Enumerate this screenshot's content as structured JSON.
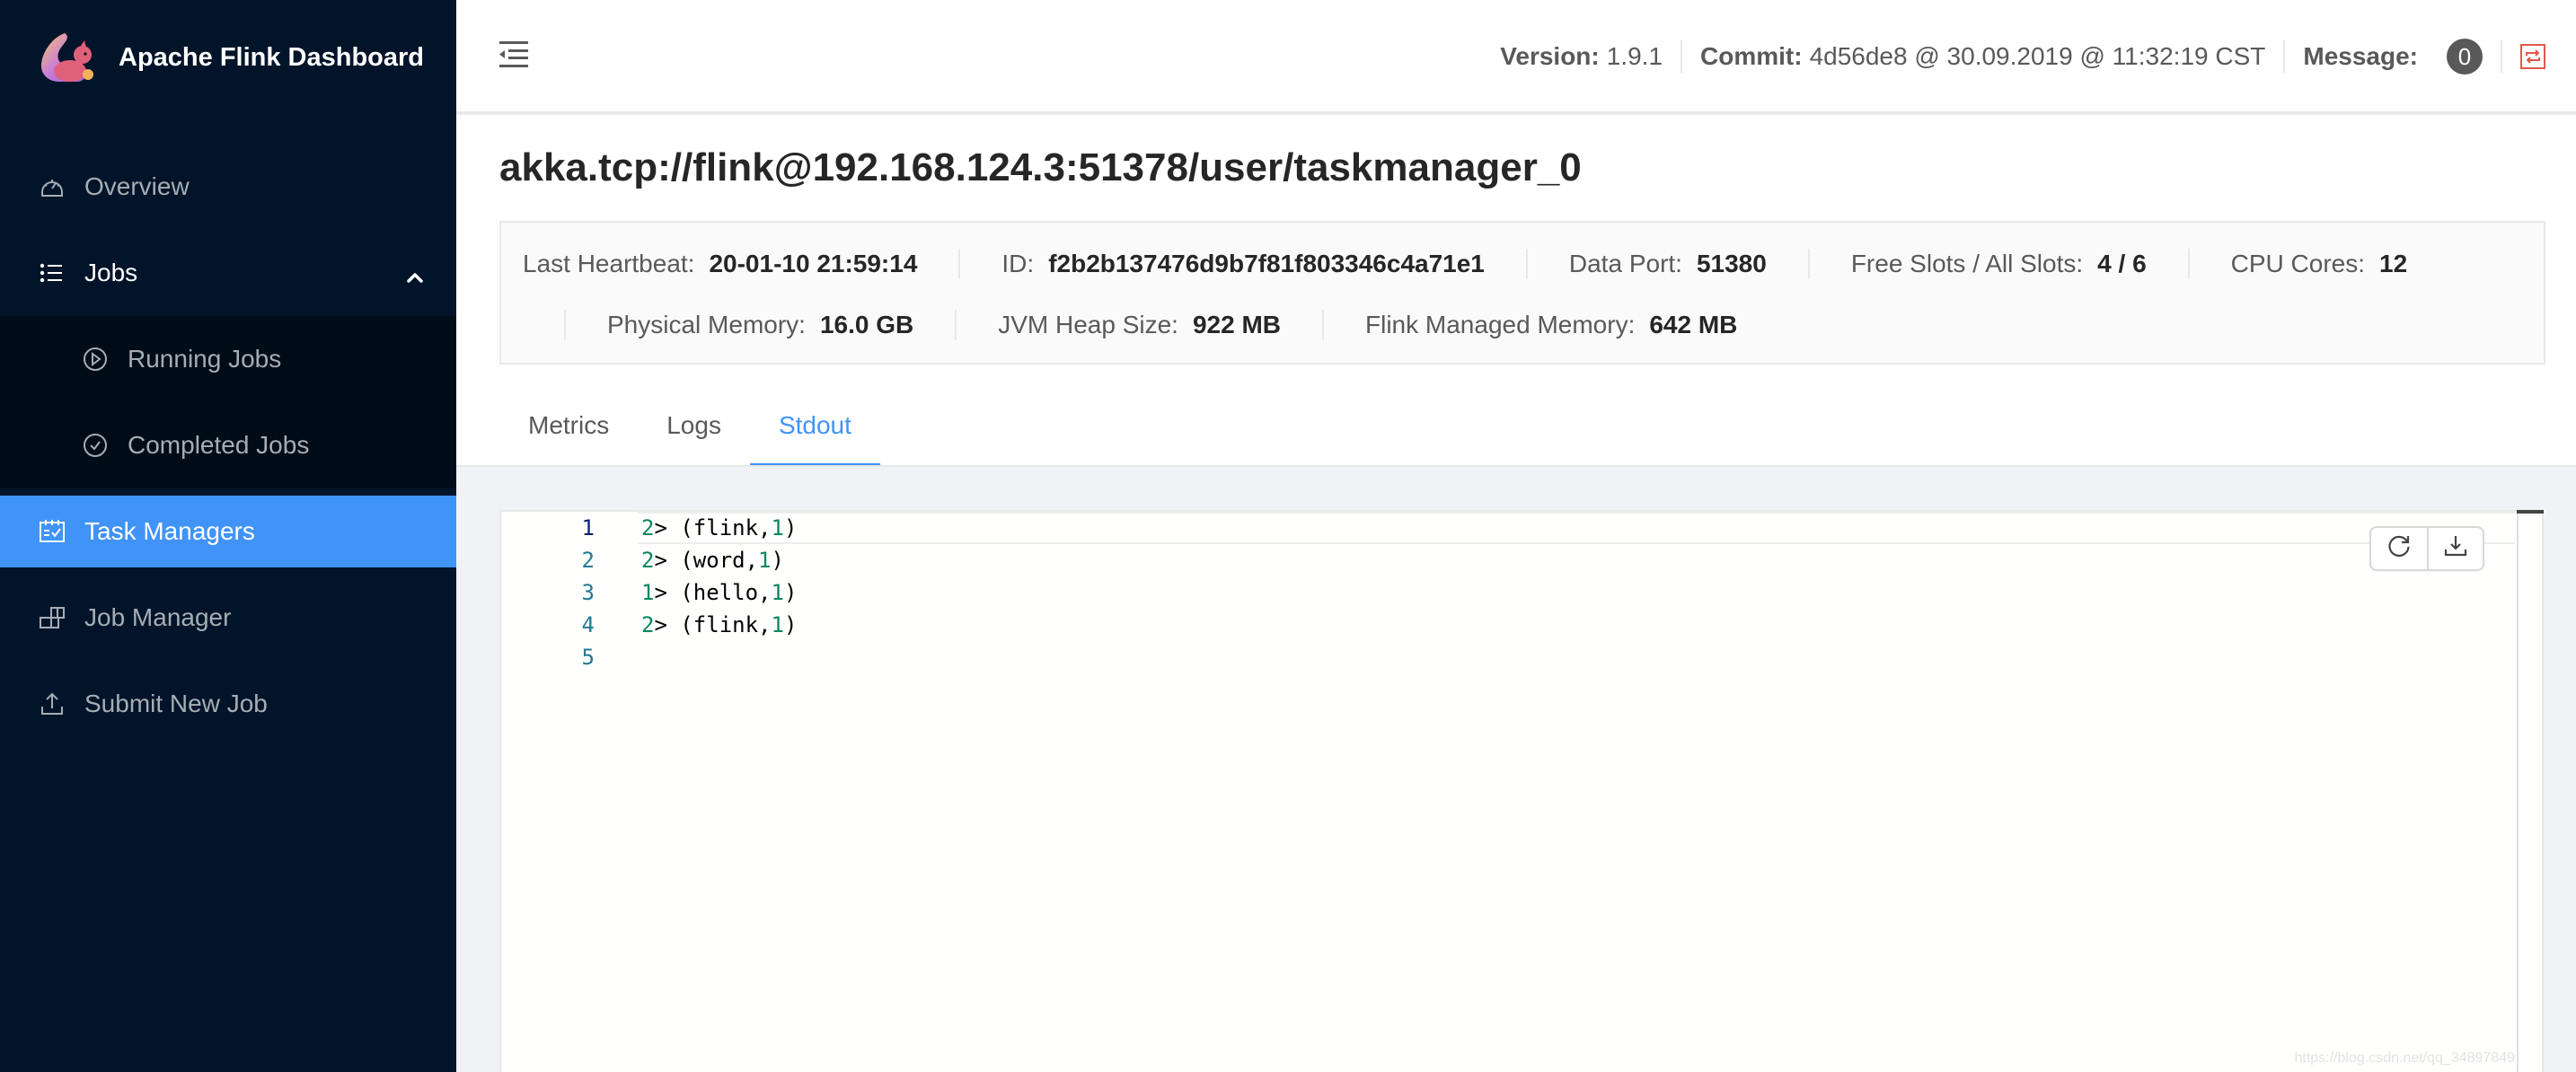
{
  "app": {
    "title": "Apache Flink Dashboard"
  },
  "sidebar": {
    "items": [
      {
        "label": "Overview",
        "icon": "dashboard-icon"
      },
      {
        "label": "Jobs",
        "icon": "list-icon",
        "expanded": true,
        "children": [
          {
            "label": "Running Jobs",
            "icon": "play-circle-icon"
          },
          {
            "label": "Completed Jobs",
            "icon": "check-circle-icon"
          }
        ]
      },
      {
        "label": "Task Managers",
        "icon": "schedule-icon",
        "active": true
      },
      {
        "label": "Job Manager",
        "icon": "build-icon"
      },
      {
        "label": "Submit New Job",
        "icon": "upload-icon"
      }
    ],
    "active_color": "#4093f7"
  },
  "header": {
    "version_label": "Version:",
    "version_value": "1.9.1",
    "commit_label": "Commit:",
    "commit_value": "4d56de8 @ 30.09.2019 @ 11:32:19 CST",
    "message_label": "Message:",
    "message_count": "0"
  },
  "page": {
    "title": "akka.tcp://flink@192.168.124.3:51378/user/taskmanager_0"
  },
  "info": {
    "row1": [
      {
        "label": "Last Heartbeat:",
        "value": "20-01-10 21:59:14"
      },
      {
        "label": "ID:",
        "value": "f2b2b137476d9b7f81f803346c4a71e1"
      },
      {
        "label": "Data Port:",
        "value": "51380"
      },
      {
        "label": "Free Slots / All Slots:",
        "value": "4 / 6"
      },
      {
        "label": "CPU Cores:",
        "value": "12"
      }
    ],
    "row2": [
      {
        "label": "Physical Memory:",
        "value": "16.0 GB"
      },
      {
        "label": "JVM Heap Size:",
        "value": "922 MB"
      },
      {
        "label": "Flink Managed Memory:",
        "value": "642 MB"
      }
    ]
  },
  "tabs": [
    {
      "label": "Metrics",
      "active": false
    },
    {
      "label": "Logs",
      "active": false
    },
    {
      "label": "Stdout",
      "active": true
    }
  ],
  "editor": {
    "lines": [
      {
        "n": "1",
        "prefix": "2",
        "rest": "> (flink,",
        "num": "1",
        "close": ")"
      },
      {
        "n": "2",
        "prefix": "2",
        "rest": "> (word,",
        "num": "1",
        "close": ")"
      },
      {
        "n": "3",
        "prefix": "1",
        "rest": "> (hello,",
        "num": "1",
        "close": ")"
      },
      {
        "n": "4",
        "prefix": "2",
        "rest": "> (flink,",
        "num": "1",
        "close": ")"
      },
      {
        "n": "5",
        "prefix": "",
        "rest": "",
        "num": "",
        "close": ""
      }
    ],
    "tools": [
      {
        "name": "reload-button",
        "icon": "reload-icon"
      },
      {
        "name": "download-button",
        "icon": "download-icon"
      }
    ]
  },
  "watermark": "https://blog.csdn.net/qq_34897849"
}
